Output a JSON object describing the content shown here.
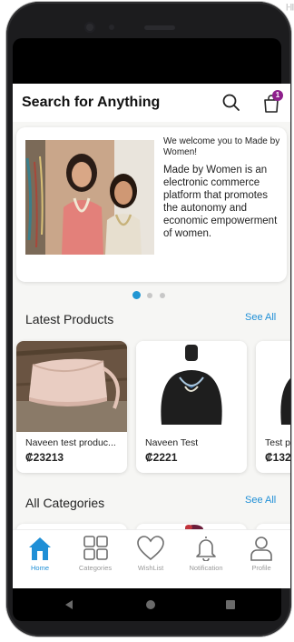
{
  "app_bar": {
    "title": "Search for Anything",
    "cart_count": "1",
    "search_icon": "search-icon",
    "cart_icon": "shopping-bag-icon"
  },
  "banner": {
    "greeting": "We welcome you to Made by Women!",
    "description": "Made by Women is an electronic commerce platform that promotes the autonomy and economic empowerment of women.",
    "dot_count": 3,
    "active_dot": 0
  },
  "latest_products": {
    "title": "Latest Products",
    "see_all": "See All",
    "items": [
      {
        "name": "Naveen test produc...",
        "price": "₡23213"
      },
      {
        "name": "Naveen Test",
        "price": "₡2221"
      },
      {
        "name": "Test p",
        "price": "₡132"
      }
    ]
  },
  "all_categories": {
    "title": "All Categories",
    "see_all": "See All"
  },
  "bottom_nav": [
    {
      "label": "Home",
      "icon": "home-icon",
      "active": true
    },
    {
      "label": "Categories",
      "icon": "grid-icon",
      "active": false
    },
    {
      "label": "WishList",
      "icon": "heart-icon",
      "active": false
    },
    {
      "label": "Notification",
      "icon": "bell-icon",
      "active": false
    },
    {
      "label": "Profile",
      "icon": "person-icon",
      "active": false
    }
  ],
  "system_nav": [
    "back-icon",
    "home-circle-icon",
    "recents-icon"
  ],
  "colors": {
    "accent": "#1f8fd6",
    "badge": "#8e1f8c",
    "background": "#f6f6f4"
  }
}
